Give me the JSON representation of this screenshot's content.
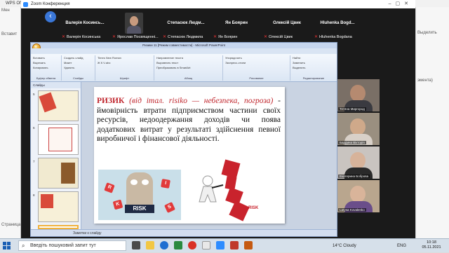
{
  "host": {
    "title": "WPS Office",
    "left_items": [
      "Мен",
      "Вставит",
      "Страница"
    ],
    "right_items": [
      "Выделить",
      "эмента)"
    ]
  },
  "zoom": {
    "title": "Zoom Конференция",
    "participants": [
      {
        "name": "Валерія  Косинсь...",
        "label": "Валерія Косинська",
        "muted": true
      },
      {
        "name": "",
        "label": "Ярослав Посвященнi...",
        "muted": true,
        "has_video": true
      },
      {
        "name": "Степасюк  Людм...",
        "label": "Степасюк Людмила",
        "muted": true
      },
      {
        "name": "Ян Боярин",
        "label": "Ян Боярин",
        "muted": true
      },
      {
        "name": "Олексій  Цвик",
        "label": "Олексій Цвик",
        "muted": true
      },
      {
        "name": "Hluhenka  Bogd...",
        "label": "Hluhenka Bogdana",
        "muted": true
      }
    ],
    "gallery": [
      {
        "label": "Тетяна Миргород",
        "skin": "#b58a70",
        "shirt": "#3a3a40",
        "bg": "#7a6f66"
      },
      {
        "label": "Бардина Вікторія",
        "skin": "#cfa98a",
        "shirt": "#d8d0c8",
        "bg": "#9a8f80"
      },
      {
        "label": "Екатерина Боброва",
        "skin": "#d7b39a",
        "shirt": "#2a2a2a",
        "bg": "#c9c4c0"
      },
      {
        "label": "Larysa Kovalenko",
        "skin": "#d9b49a",
        "shirt": "#6a4e8a",
        "bg": "#b9a68e"
      }
    ]
  },
  "ppt": {
    "window_title": "Ризики 11 [Режим совместимости] - Microsoft PowerPoint",
    "tabs": [
      "Главная",
      "Вставка",
      "Дизайн",
      "Анимация",
      "Показ слайдов",
      "Рецензирование",
      "Вид",
      "Foxit Reader PDF"
    ],
    "ribbon_groups": [
      {
        "label": "Буфер обмена",
        "rows": [
          "Вставить",
          "Вырезать",
          "Копировать"
        ]
      },
      {
        "label": "Слайды",
        "rows": [
          "Создать слайд",
          "Макет",
          "Удалить"
        ]
      },
      {
        "label": "Шрифт",
        "rows": [
          "Times New Roman",
          "Ж К Ч abc"
        ]
      },
      {
        "label": "Абзац",
        "rows": [
          "Направление текста",
          "Выровнять текст",
          "Преобразовать в SmartArt"
        ]
      },
      {
        "label": "Рисование",
        "rows": [
          "Упорядочить",
          "Экспресс-стили"
        ]
      },
      {
        "label": "Редактирование",
        "rows": [
          "Найти",
          "Заменить",
          "Выделить"
        ]
      }
    ],
    "panel_tabs": "Слайды",
    "thumbnails": [
      "5",
      "6",
      "7",
      "8",
      "9"
    ],
    "notes": "Заметки к слайду",
    "slide": {
      "term": "РИЗИК",
      "etymology": "(від італ. risiko — небезпека, погроза)",
      "definition": " - ймовірність втрати підприємством частини своїх ресурсів, недоодержання доходів чи поява додаткових витрат у результаті здійснення певної виробничої і фінансової діяльності.",
      "image_left_text": "RISK",
      "image_right_text": "RISK"
    }
  },
  "taskbar": {
    "search_placeholder": "Введіть пошуковий запит тут",
    "weather": "14°C  Cloudy",
    "lang": "ENG",
    "time": "10:18",
    "date": "05.11.2021"
  }
}
